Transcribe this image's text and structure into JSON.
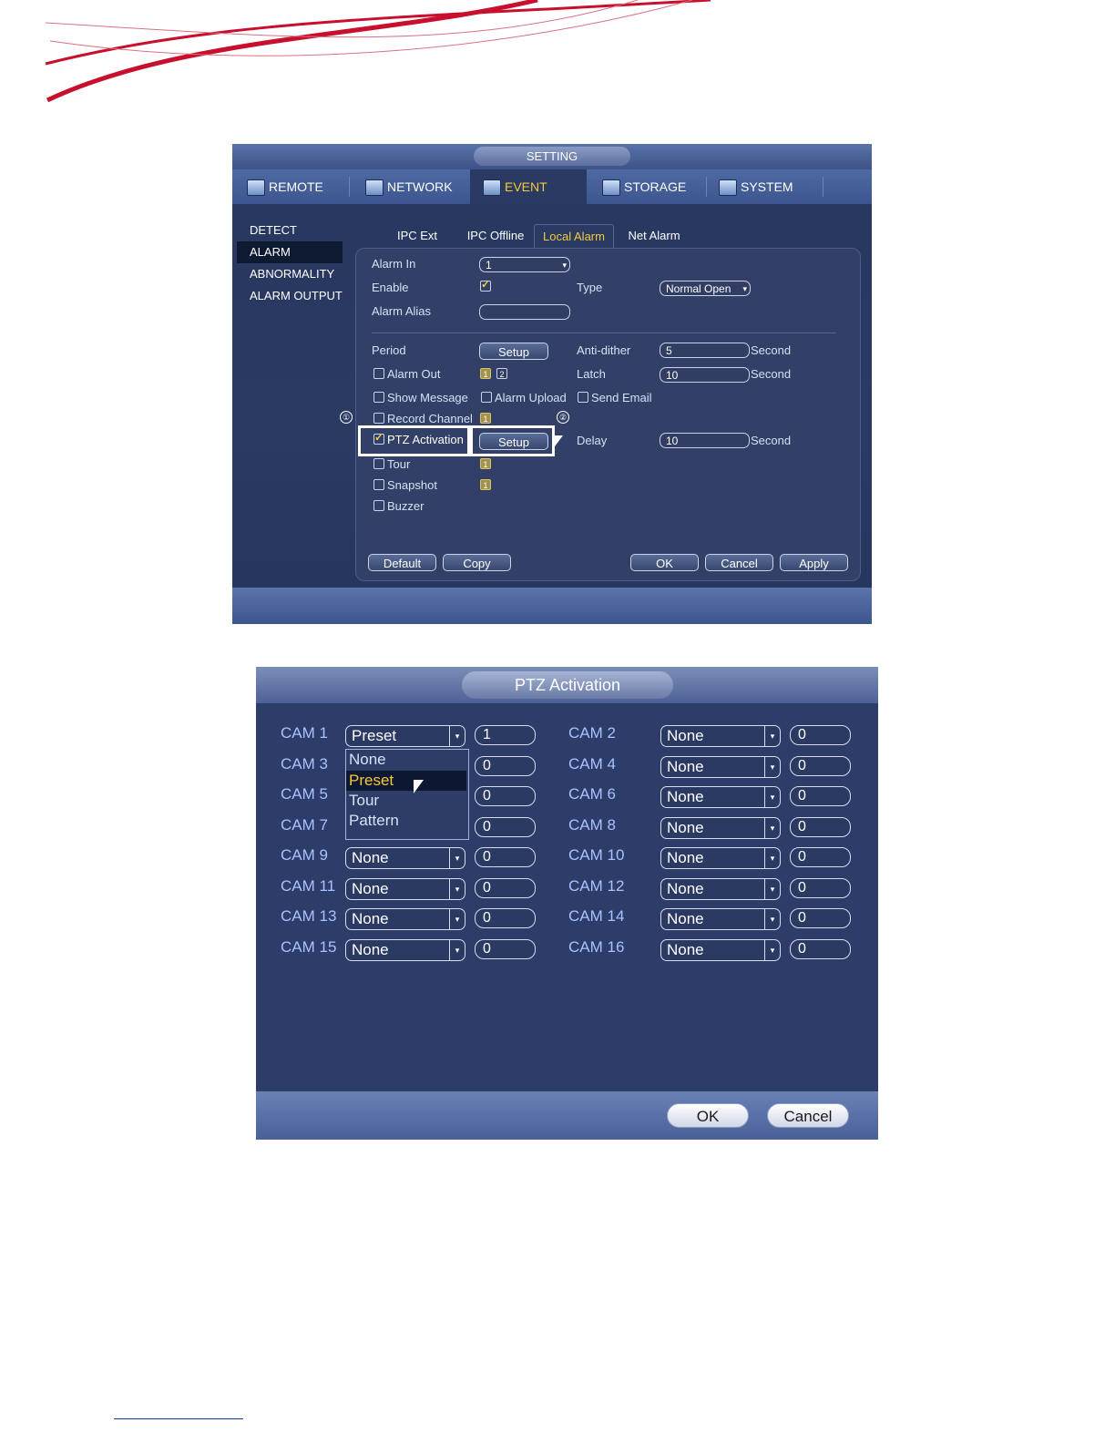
{
  "setting": {
    "title": "SETTING",
    "tabs": [
      "REMOTE",
      "NETWORK",
      "EVENT",
      "STORAGE",
      "SYSTEM"
    ],
    "sidebar": [
      "DETECT",
      "ALARM",
      "ABNORMALITY",
      "ALARM OUTPUT"
    ],
    "subtabs": [
      "IPC Ext",
      "IPC Offline",
      "Local Alarm",
      "Net Alarm"
    ],
    "labels": {
      "alarm_in": "Alarm In",
      "enable": "Enable",
      "type": "Type",
      "alarm_alias": "Alarm Alias",
      "period": "Period",
      "anti_dither": "Anti-dither",
      "alarm_out": "Alarm Out",
      "latch": "Latch",
      "show_message": "Show Message",
      "alarm_upload": "Alarm Upload",
      "send_email": "Send Email",
      "record_channel": "Record Channel",
      "ptz_activation": "PTZ Activation",
      "delay": "Delay",
      "tour": "Tour",
      "snapshot": "Snapshot",
      "buzzer": "Buzzer",
      "second": "Second"
    },
    "values": {
      "alarm_in": "1",
      "type": "Normal Open",
      "alarm_alias": "",
      "anti_dither": "5",
      "latch": "10",
      "delay": "10"
    },
    "setup_label": "Setup",
    "channel_nums": [
      "1",
      "2"
    ],
    "markers": [
      "①",
      "②"
    ],
    "buttons": {
      "default": "Default",
      "copy": "Copy",
      "ok": "OK",
      "cancel": "Cancel",
      "apply": "Apply"
    }
  },
  "ptz": {
    "title": "PTZ Activation",
    "cams": [
      {
        "name": "CAM 1",
        "type": "Preset",
        "value": "1"
      },
      {
        "name": "CAM 2",
        "type": "None",
        "value": "0"
      },
      {
        "name": "CAM 3",
        "type": "",
        "value": "0"
      },
      {
        "name": "CAM 4",
        "type": "None",
        "value": "0"
      },
      {
        "name": "CAM 5",
        "type": "",
        "value": "0"
      },
      {
        "name": "CAM 6",
        "type": "None",
        "value": "0"
      },
      {
        "name": "CAM 7",
        "type": "",
        "value": "0"
      },
      {
        "name": "CAM 8",
        "type": "None",
        "value": "0"
      },
      {
        "name": "CAM 9",
        "type": "None",
        "value": "0"
      },
      {
        "name": "CAM 10",
        "type": "None",
        "value": "0"
      },
      {
        "name": "CAM 11",
        "type": "None",
        "value": "0"
      },
      {
        "name": "CAM 12",
        "type": "None",
        "value": "0"
      },
      {
        "name": "CAM 13",
        "type": "None",
        "value": "0"
      },
      {
        "name": "CAM 14",
        "type": "None",
        "value": "0"
      },
      {
        "name": "CAM 15",
        "type": "None",
        "value": "0"
      },
      {
        "name": "CAM 16",
        "type": "None",
        "value": "0"
      }
    ],
    "dropdown_options": [
      "None",
      "Preset",
      "Tour",
      "Pattern"
    ],
    "ok_label": "OK",
    "cancel_label": "Cancel"
  },
  "colors": {
    "accent": "#f3c93c",
    "panel": "#2d3c68",
    "decor": "#c8102e"
  }
}
